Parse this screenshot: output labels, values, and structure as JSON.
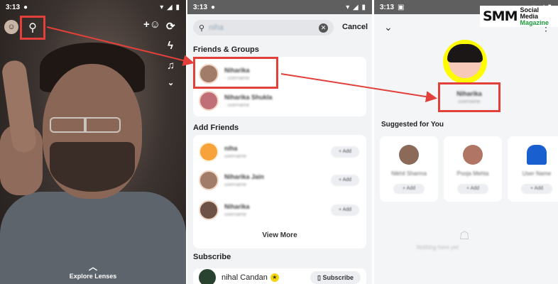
{
  "status": {
    "time": "3:13"
  },
  "camera": {
    "explore_label": "Explore Lenses"
  },
  "search": {
    "query": "niha",
    "cancel_label": "Cancel",
    "friends_groups_title": "Friends & Groups",
    "add_friends_title": "Add Friends",
    "view_more_label": "View More",
    "subscribe_title": "Subscribe",
    "subscribe_item": {
      "name": "nihal Candan",
      "button_label": "Subscribe"
    }
  },
  "profile": {
    "suggested_title": "Suggested for You"
  },
  "logo": {
    "letters": "SMM",
    "line1": "Social Media",
    "line2": "Magazine"
  },
  "colors": {
    "highlight": "#e2403a",
    "snap_yellow": "#fffc00",
    "logo_green": "#1a9e3a"
  }
}
